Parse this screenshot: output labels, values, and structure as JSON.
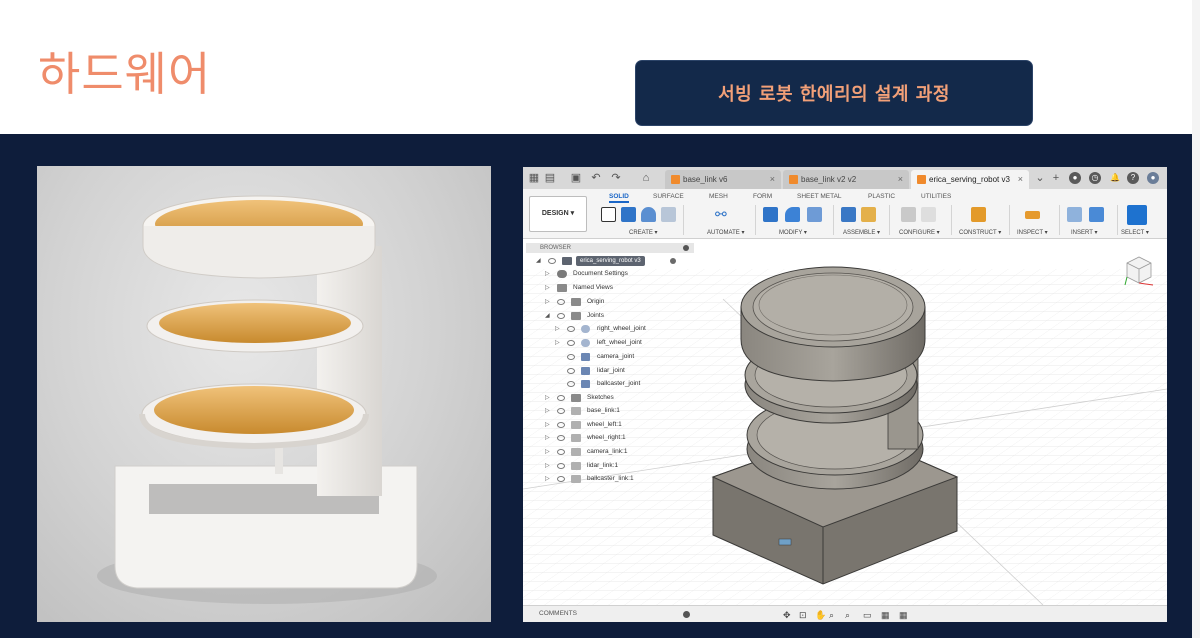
{
  "slide": {
    "title": "하드웨어",
    "subtitle": "서빙 로봇 한에리의 설계 과정"
  },
  "colors": {
    "title": "#ef8c6b",
    "subtitle_text": "#f2a078",
    "subtitle_bg": "#13294a",
    "slide_bg": "#0e1d3b",
    "accent": "#1a66c7"
  },
  "fusion": {
    "tabs": [
      {
        "label": "base_link v6",
        "active": false
      },
      {
        "label": "base_link v2 v2",
        "active": false
      },
      {
        "label": "erica_serving_robot v3",
        "active": true
      }
    ],
    "design_button": "DESIGN ▾",
    "workspace_tabs": [
      "SOLID",
      "SURFACE",
      "MESH",
      "FORM",
      "SHEET METAL",
      "PLASTIC",
      "UTILITIES"
    ],
    "groups": [
      "CREATE ▾",
      "AUTOMATE ▾",
      "MODIFY ▾",
      "ASSEMBLE ▾",
      "CONFIGURE ▾",
      "CONSTRUCT ▾",
      "INSPECT ▾",
      "INSERT ▾",
      "SELECT ▾"
    ],
    "browser": {
      "header": "BROWSER",
      "root": "erica_serving_robot v3",
      "items": [
        {
          "label": "Document Settings"
        },
        {
          "label": "Named Views"
        },
        {
          "label": "Origin"
        },
        {
          "label": "Joints"
        },
        {
          "label": "right_wheel_joint"
        },
        {
          "label": "left_wheel_joint"
        },
        {
          "label": "camera_joint"
        },
        {
          "label": "lidar_joint"
        },
        {
          "label": "ballcaster_joint"
        },
        {
          "label": "Sketches"
        },
        {
          "label": "base_link:1"
        },
        {
          "label": "wheel_left:1"
        },
        {
          "label": "wheel_right:1"
        },
        {
          "label": "camera_link:1"
        },
        {
          "label": "lidar_link:1"
        },
        {
          "label": "ballcaster_link:1"
        }
      ]
    },
    "comments_label": "COMMENTS"
  }
}
